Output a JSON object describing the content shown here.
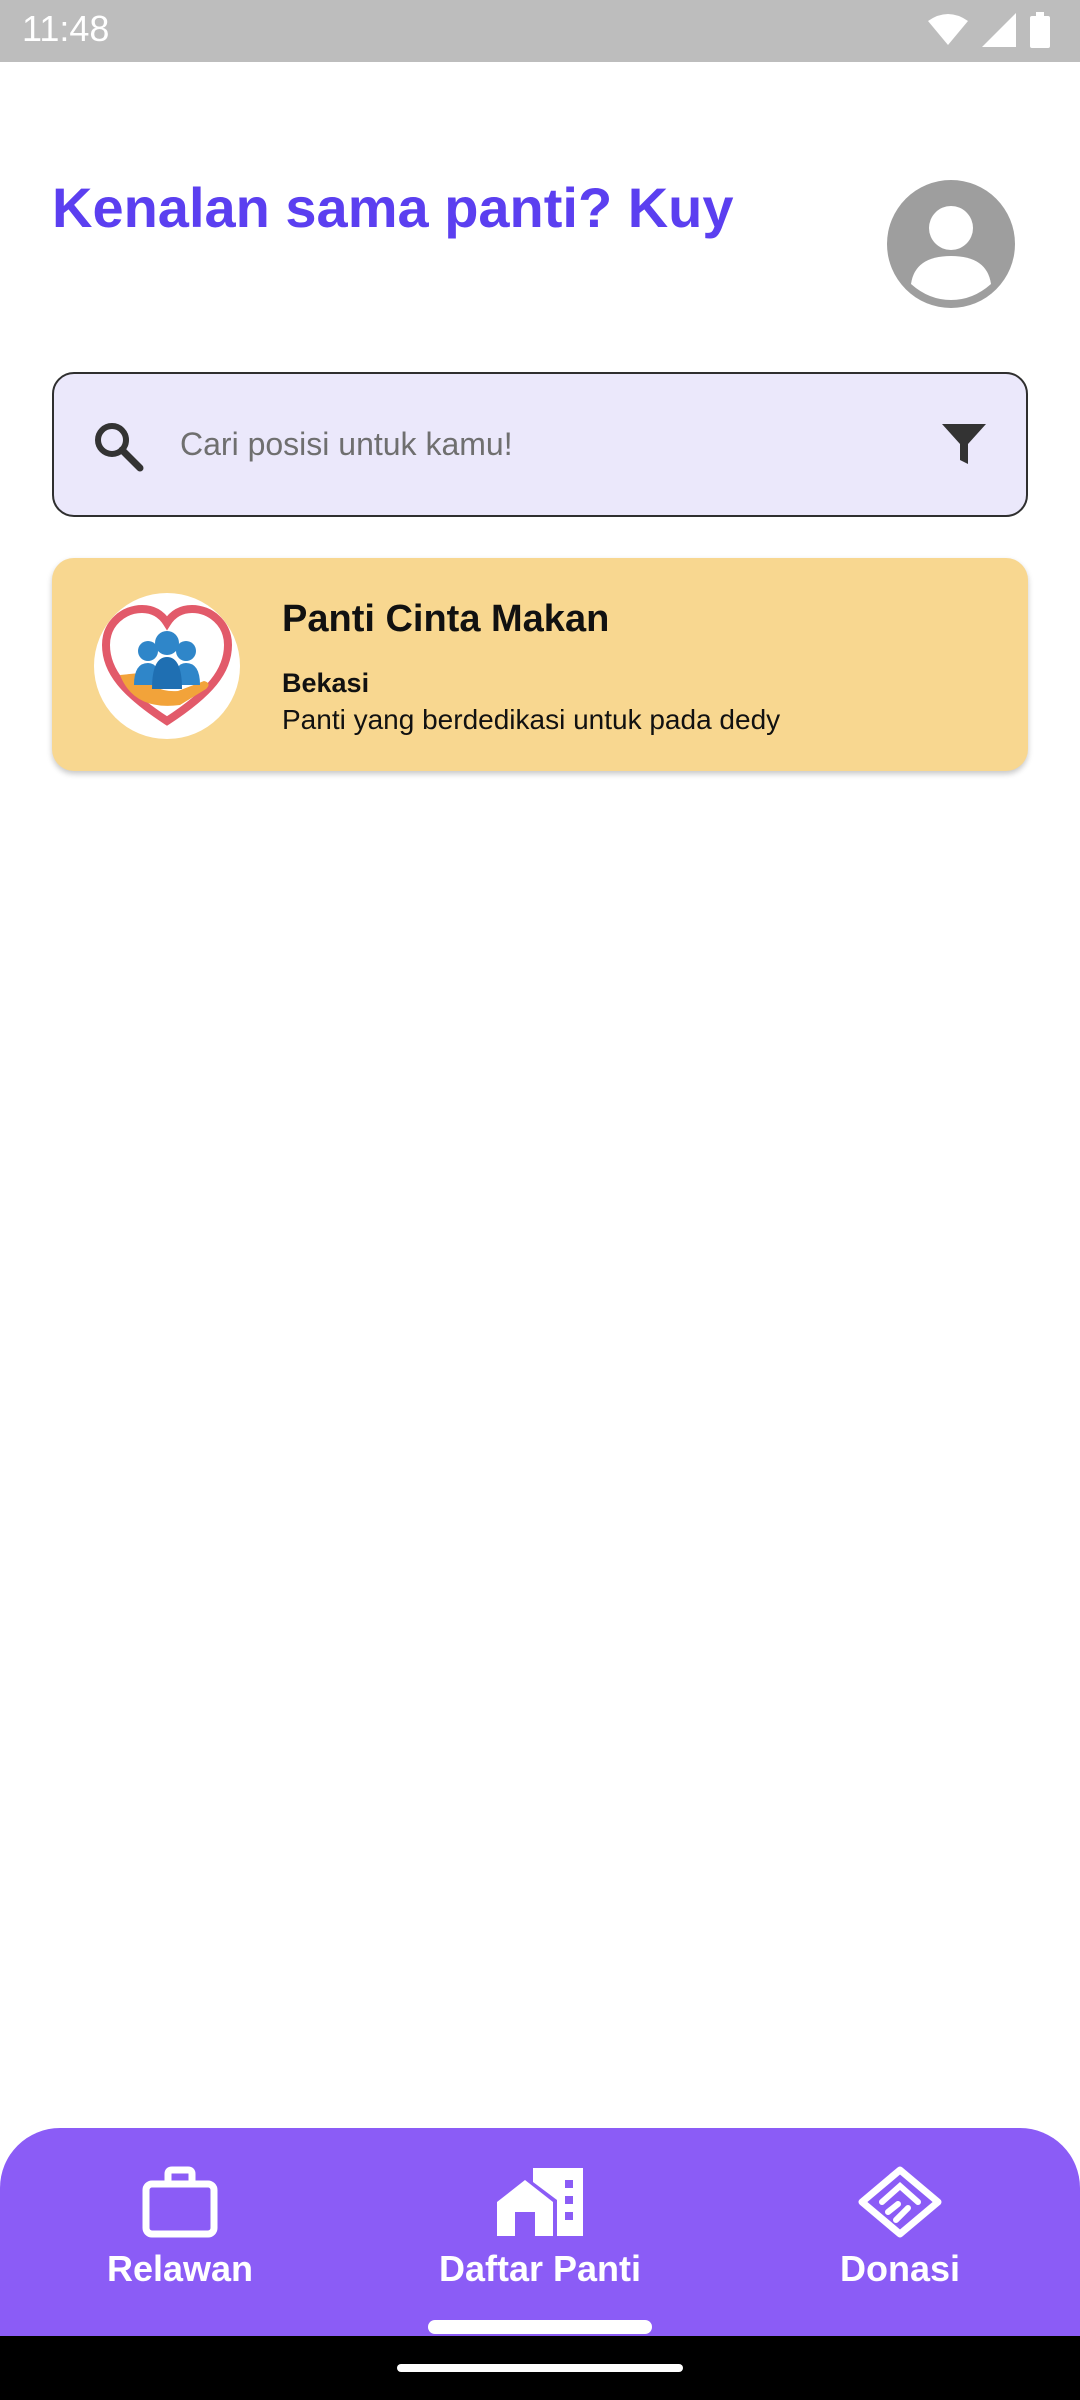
{
  "status_bar": {
    "time": "11:48",
    "icons": [
      "wifi-icon",
      "signal-icon",
      "battery-icon"
    ]
  },
  "header": {
    "title": "Kenalan sama panti? Kuy",
    "avatar_icon": "account-circle-icon"
  },
  "search": {
    "placeholder": "Cari posisi untuk kamu!",
    "search_icon": "search-icon",
    "filter_icon": "filter-icon"
  },
  "panti_list": [
    {
      "name": "Panti Cinta Makan",
      "location": "Bekasi",
      "description": "Panti yang berdedikasi untuk pada dedy",
      "logo_icon": "panti-logo-heart-hands"
    }
  ],
  "bottom_nav": {
    "items": [
      {
        "label": "Relawan",
        "icon": "briefcase-icon",
        "active": false
      },
      {
        "label": "Daftar Panti",
        "icon": "house-icon",
        "active": true
      },
      {
        "label": "Donasi",
        "icon": "handshake-icon",
        "active": false
      }
    ]
  },
  "colors": {
    "accent": "#5b3ff0",
    "nav_background": "#8b5cf6",
    "search_background": "#ebe8fb",
    "card_background": "#f8d790"
  }
}
